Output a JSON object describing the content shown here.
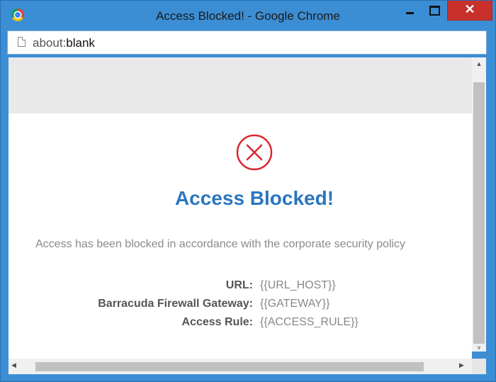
{
  "window": {
    "title": "Access Blocked! - Google Chrome",
    "close_glyph": "✕"
  },
  "addressbar": {
    "scheme": "about:",
    "host": "blank"
  },
  "page": {
    "heading": "Access Blocked!",
    "message": "Access has been blocked in accordance with the corporate security policy",
    "info": [
      {
        "label": "URL:",
        "value": "{{URL_HOST}}"
      },
      {
        "label": "Barracuda Firewall Gateway:",
        "value": "{{GATEWAY}}"
      },
      {
        "label": "Access Rule:",
        "value": "{{ACCESS_RULE}}"
      }
    ]
  },
  "icons": {
    "browser": "chrome-icon",
    "error": "blocked-x-circle-icon",
    "page": "blank-page-icon"
  },
  "colors": {
    "heading": "#2c76be",
    "error_icon": "#d9262f",
    "titlebar": "#3c8ed4",
    "close_button": "#c7302b"
  }
}
